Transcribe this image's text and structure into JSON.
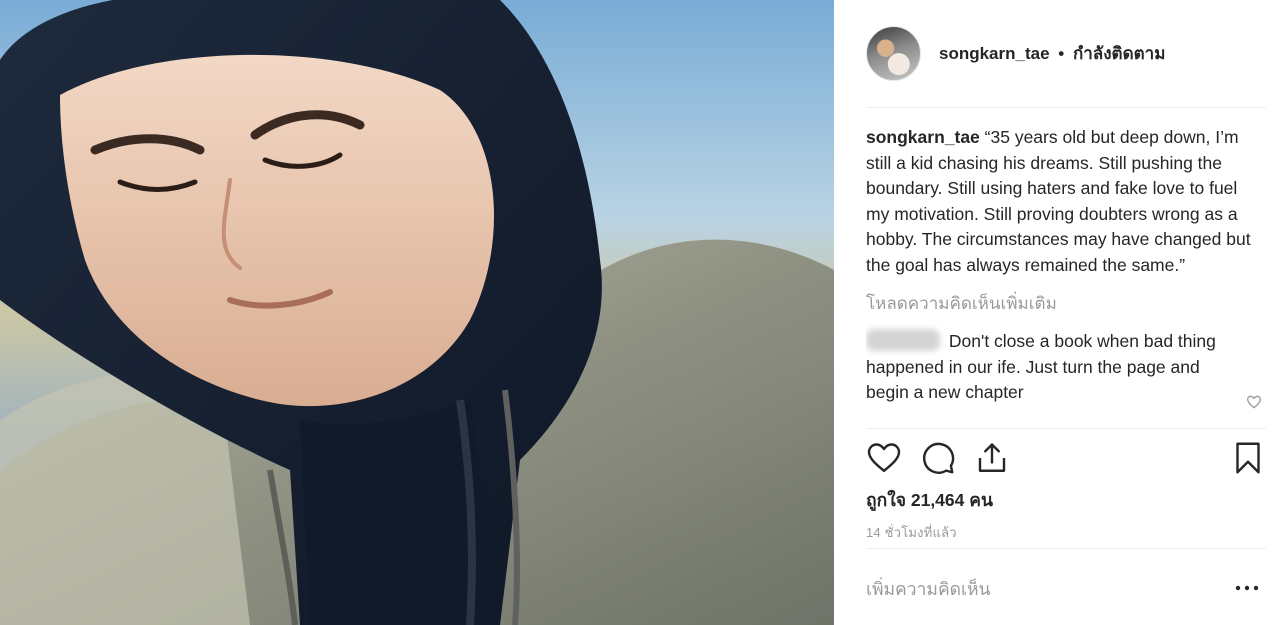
{
  "post": {
    "photo": {
      "icon": "photo-man-in-hoodie"
    },
    "header": {
      "username": "songkarn_tae",
      "separator": "•",
      "follow_status": "กำลังติดตาม"
    },
    "caption": {
      "username": "songkarn_tae",
      "text": "“35 years old but deep down, I’m still a kid chasing his dreams. Still pushing the boundary. Still using haters and fake love to fuel my motivation. Still proving doubters wrong as a hobby. The circumstances may have changed but the goal has always remained the same.”"
    },
    "load_more_comments": "โหลดความคิดเห็นเพิ่มเติม",
    "comments": [
      {
        "text": "Don't close a book when bad thing happened in our ife. Just turn the page and begin a new chapter"
      }
    ],
    "likes_text": "ถูกใจ 21,464 คน",
    "timestamp": "14 ชั่วโมงที่แล้ว",
    "add_comment_placeholder": "เพิ่มความคิดเห็น",
    "icons": {
      "like": "heart-icon",
      "comment": "comment-bubble-icon",
      "share": "share-icon",
      "save": "bookmark-icon",
      "more": "more-dots-icon"
    }
  }
}
